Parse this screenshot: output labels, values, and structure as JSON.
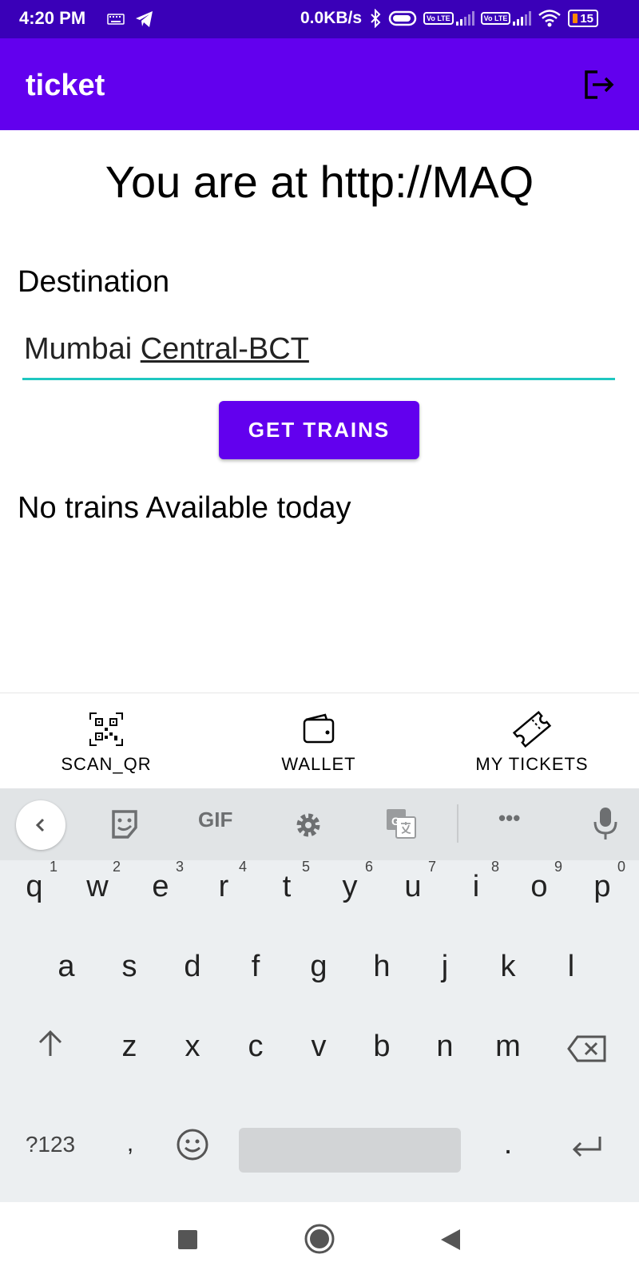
{
  "status_bar": {
    "time": "4:20 PM",
    "speed": "0.0KB/s",
    "battery": "15",
    "volte_label": "Vo LTE"
  },
  "app_bar": {
    "title": "ticket"
  },
  "main": {
    "location_text": "You are at http://MAQ",
    "destination_label": "Destination",
    "destination_value_part1": "Mumbai ",
    "destination_value_part2": "Central-BCT",
    "get_trains_label": "GET TRAINS",
    "status_message": "No trains Available today"
  },
  "bottom_nav": {
    "items": [
      {
        "label": "SCAN_QR",
        "icon": "qr-code-icon"
      },
      {
        "label": "WALLET",
        "icon": "wallet-icon"
      },
      {
        "label": "MY TICKETS",
        "icon": "ticket-icon"
      }
    ]
  },
  "keyboard": {
    "toolbar": {
      "gif_label": "GIF",
      "more_label": "•••"
    },
    "row1": [
      "q",
      "w",
      "e",
      "r",
      "t",
      "y",
      "u",
      "i",
      "o",
      "p"
    ],
    "row1_hints": [
      "1",
      "2",
      "3",
      "4",
      "5",
      "6",
      "7",
      "8",
      "9",
      "0"
    ],
    "row2": [
      "a",
      "s",
      "d",
      "f",
      "g",
      "h",
      "j",
      "k",
      "l"
    ],
    "row3": [
      "z",
      "x",
      "c",
      "v",
      "b",
      "n",
      "m"
    ],
    "row4": {
      "symbols_label": "?123",
      "comma": ",",
      "period": "."
    }
  },
  "colors": {
    "status_bar": "#3a00b8",
    "primary": "#6200ee",
    "input_underline": "#1fc7c0"
  }
}
